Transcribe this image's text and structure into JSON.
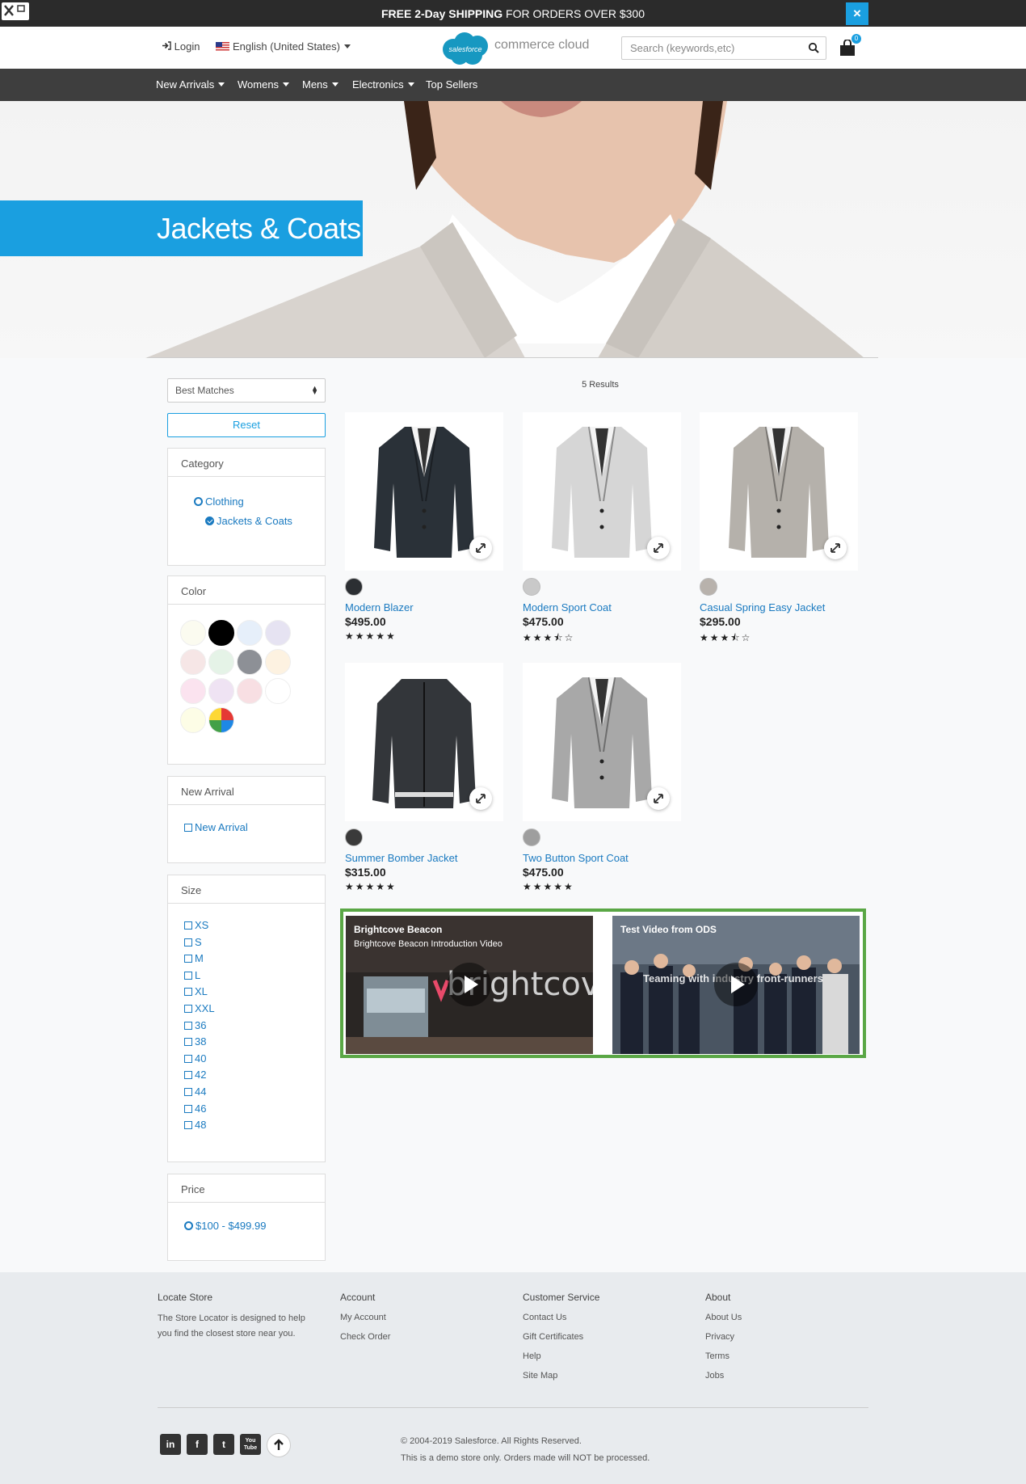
{
  "banner": {
    "bold": "FREE 2-Day SHIPPING",
    "rest": " FOR ORDERS OVER $300",
    "close": "×"
  },
  "header": {
    "login": "Login",
    "language": "English (United States)",
    "logo_badge": "salesforce",
    "logo_text": "commerce cloud",
    "search_placeholder": "Search (keywords,etc)",
    "cart_count": "0"
  },
  "nav": {
    "items": [
      "New Arrivals",
      "Womens",
      "Mens",
      "Electronics",
      "Top Sellers"
    ]
  },
  "hero": {
    "title": "Jackets & Coats"
  },
  "sort": {
    "selected": "Best Matches"
  },
  "reset_label": "Reset",
  "filters": {
    "category": {
      "title": "Category",
      "items": [
        "Clothing",
        "Jackets & Coats"
      ]
    },
    "color": {
      "title": "Color",
      "swatches": [
        "#fbfbf0",
        "#000000",
        "#e6effa",
        "#e6e3f2",
        "#f6e6e6",
        "#e5f3e7",
        "#8d9096",
        "#fdf2e1",
        "#fbe3ef",
        "#efe3f3",
        "#f8dfe3",
        "#ffffff",
        "#fdfde6",
        "multi"
      ]
    },
    "new_arrival": {
      "title": "New Arrival",
      "items": [
        "New Arrival"
      ]
    },
    "size": {
      "title": "Size",
      "items": [
        "XS",
        "S",
        "M",
        "L",
        "XL",
        "XXL",
        "36",
        "38",
        "40",
        "42",
        "44",
        "46",
        "48"
      ]
    },
    "price": {
      "title": "Price",
      "items": [
        "$100 - $499.99"
      ]
    }
  },
  "results": {
    "count_label": "5 Results"
  },
  "products": [
    {
      "name": "Modern Blazer",
      "price": "$495.00",
      "rating": 5,
      "swatch": "#2c2f33",
      "garment": "#2a3138"
    },
    {
      "name": "Modern Sport Coat",
      "price": "$475.00",
      "rating": 3.5,
      "swatch": "#c9c9c9",
      "garment": "#d6d6d6"
    },
    {
      "name": "Casual Spring Easy Jacket",
      "price": "$295.00",
      "rating": 3.5,
      "swatch": "#b8b2ac",
      "garment": "#b5b1ab"
    },
    {
      "name": "Summer Bomber Jacket",
      "price": "$315.00",
      "rating": 5,
      "swatch": "#3a3a3a",
      "garment": "#33363a"
    },
    {
      "name": "Two Button Sport Coat",
      "price": "$475.00",
      "rating": 5,
      "swatch": "#9e9e9e",
      "garment": "#a8a8a8"
    }
  ],
  "videos": [
    {
      "title": "Brightcove Beacon",
      "subtitle": "Brightcove Beacon Introduction Video",
      "overlay": "brightcove"
    },
    {
      "title": "Test Video from ODS",
      "subtitle": "",
      "overlay": "Teaming with industry front-runners"
    }
  ],
  "footer": {
    "locate": {
      "title": "Locate Store",
      "text": "The Store Locator is designed to help you find the closest store near you."
    },
    "account": {
      "title": "Account",
      "links": [
        "My Account",
        "Check Order"
      ]
    },
    "service": {
      "title": "Customer Service",
      "links": [
        "Contact Us",
        "Gift Certificates",
        "Help",
        "Site Map"
      ]
    },
    "about": {
      "title": "About",
      "links": [
        "About Us",
        "Privacy",
        "Terms",
        "Jobs"
      ]
    },
    "social": [
      "in",
      "f",
      "t",
      "You Tube"
    ],
    "copyright": "© 2004-2019 Salesforce. All Rights Reserved.",
    "disclaimer": "This is a demo store only. Orders made will NOT be processed."
  }
}
